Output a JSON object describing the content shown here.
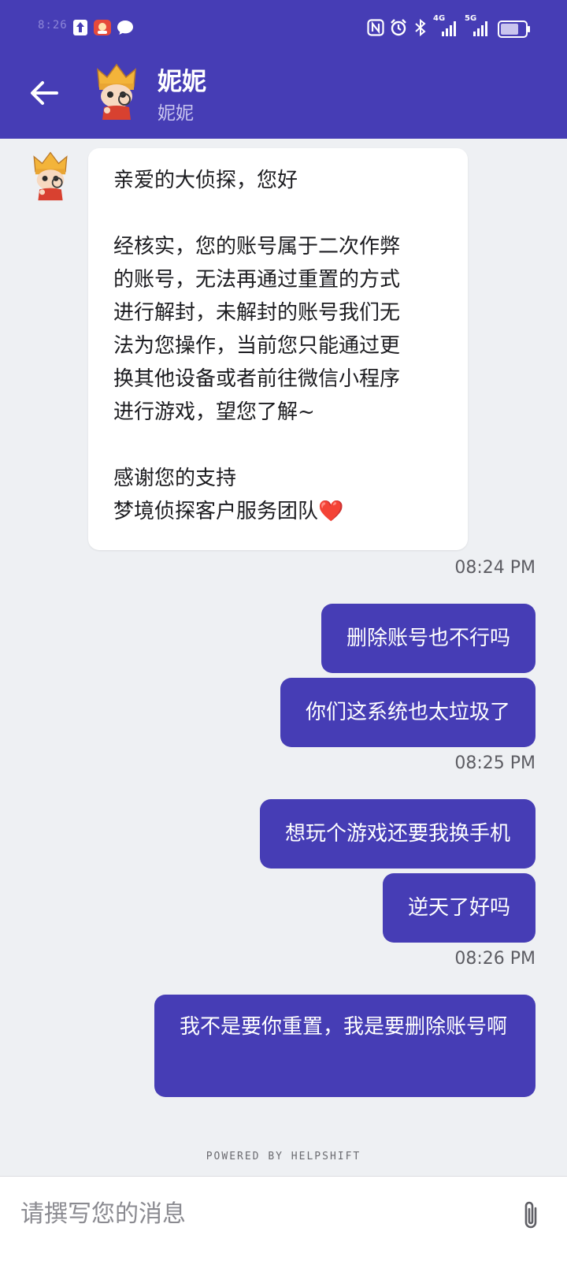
{
  "status_bar": {
    "time": "8:26",
    "network_1": "4G",
    "network_2": "5G",
    "icons": [
      "upload-icon",
      "app-notification-icon",
      "message-icon",
      "nfc-icon",
      "alarm-icon",
      "bluetooth-icon",
      "signal-icon",
      "battery-icon"
    ]
  },
  "header": {
    "name": "妮妮",
    "subtitle": "妮妮",
    "back_icon": "arrow-left-icon"
  },
  "theme": {
    "primary": "#463db5",
    "background": "#eef0f3",
    "bubble_in": "#ffffff"
  },
  "messages": {
    "incoming": {
      "lines": [
        "亲爱的大侦探，您好",
        "",
        "经核实，您的账号属于二次作弊",
        "的账号，无法再通过重置的方式",
        "进行解封，未解封的账号我们无",
        "法为您操作，当前您只能通过更",
        "换其他设备或者前往微信小程序",
        "进行游戏，望您了解~",
        "",
        "感谢您的支持",
        "梦境侦探客户服务团队"
      ],
      "emoji": "❤️"
    },
    "groups": [
      {
        "time": "08:24 PM",
        "items": [
          "删除账号也不行吗",
          "你们这系统也太垃圾了"
        ]
      },
      {
        "time": "08:25 PM",
        "items": [
          "想玩个游戏还要我换手机",
          "逆天了好吗"
        ]
      },
      {
        "time": "08:26 PM",
        "items": [
          "我不是要你重置，我是要删除账号啊"
        ]
      }
    ]
  },
  "footer": {
    "powered_by": "POWERED BY HELPSHIFT",
    "input_placeholder": "请撰写您的消息",
    "attach_icon": "paperclip-icon"
  }
}
